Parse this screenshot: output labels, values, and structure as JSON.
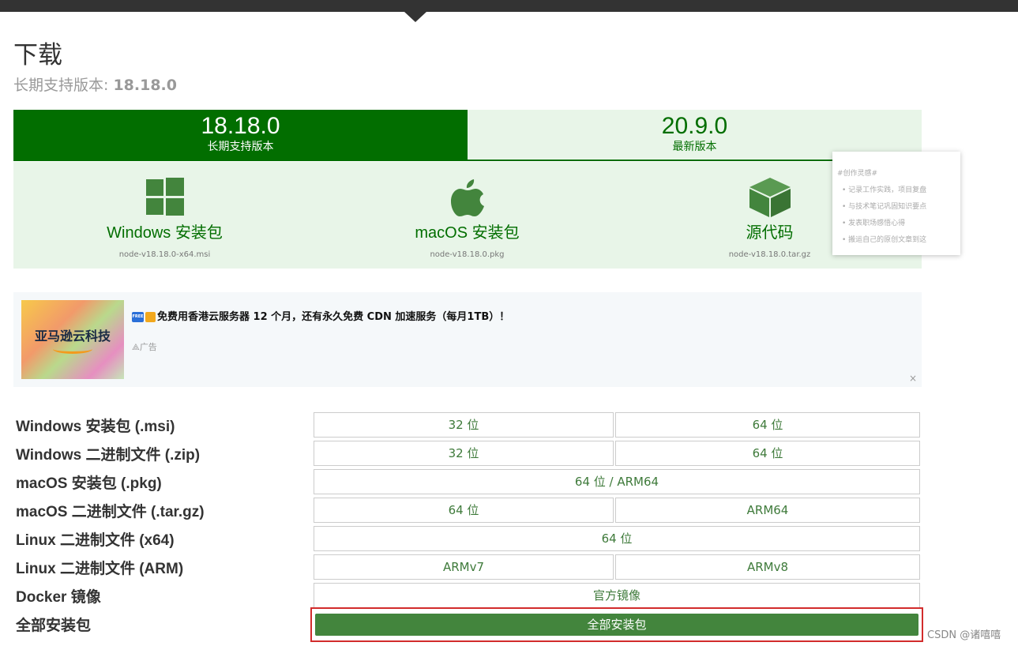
{
  "page": {
    "title": "下载",
    "lts_prefix": "长期支持版本: ",
    "lts_version": "18.18.0"
  },
  "tabs": [
    {
      "version": "18.18.0",
      "label": "长期支持版本",
      "selected": true
    },
    {
      "version": "20.9.0",
      "label": "最新版本",
      "selected": false
    }
  ],
  "downloads": [
    {
      "icon": "windows-logo-icon",
      "label": "Windows 安装包",
      "file": "node-v18.18.0-x64.msi"
    },
    {
      "icon": "apple-logo-icon",
      "label": "macOS 安装包",
      "file": "node-v18.18.0.pkg"
    },
    {
      "icon": "cube-icon",
      "label": "源代码",
      "file": "node-v18.18.0.tar.gz"
    }
  ],
  "note": {
    "title": "#创作灵感#",
    "items": [
      "记录工作实践，项目复盘",
      "与技术笔记巩固知识要点",
      "发表职场感悟心得",
      "搬运自己的原创文章到这"
    ]
  },
  "ad": {
    "image_text": "亚马逊云科技",
    "badge": "FREE",
    "headline": "免费用香港云服务器 12 个月，还有永久免费 CDN 加速服务（每月1TB）！",
    "tag": "广告",
    "close": "×"
  },
  "table": [
    {
      "label": "Windows 安装包 (.msi)",
      "cells": [
        "32 位",
        "64 位"
      ]
    },
    {
      "label": "Windows 二进制文件 (.zip)",
      "cells": [
        "32 位",
        "64 位"
      ]
    },
    {
      "label": "macOS 安装包 (.pkg)",
      "cells": [
        "64 位 / ARM64"
      ]
    },
    {
      "label": "macOS 二进制文件 (.tar.gz)",
      "cells": [
        "64 位",
        "ARM64"
      ]
    },
    {
      "label": "Linux 二进制文件 (x64)",
      "cells": [
        "64 位"
      ]
    },
    {
      "label": "Linux 二进制文件 (ARM)",
      "cells": [
        "ARMv7",
        "ARMv8"
      ]
    },
    {
      "label": "Docker 镜像",
      "cells": [
        "官方镜像"
      ]
    },
    {
      "label": "全部安装包",
      "cells": [
        "全部安装包"
      ]
    }
  ],
  "watermark": "CSDN @诸嘻嘻",
  "colors": {
    "brand_green": "#026e00",
    "button_green": "#43853d",
    "highlight_red": "#d22c2c"
  }
}
